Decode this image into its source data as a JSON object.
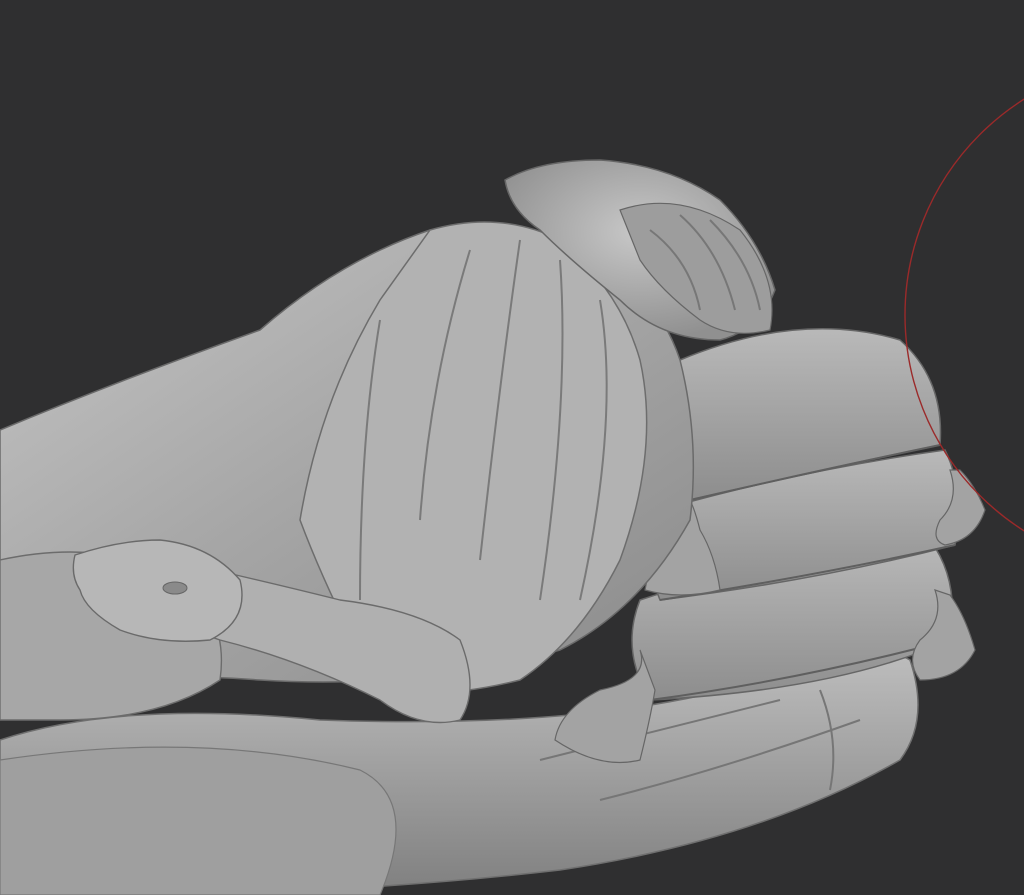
{
  "app": {
    "view": "3d-sculpt-viewport",
    "background_color": "#2f2f30",
    "model_color": "#a9a9a9",
    "brush_cursor_color": "#9b2a2a",
    "icons": [
      "brush-cursor-icon"
    ]
  }
}
